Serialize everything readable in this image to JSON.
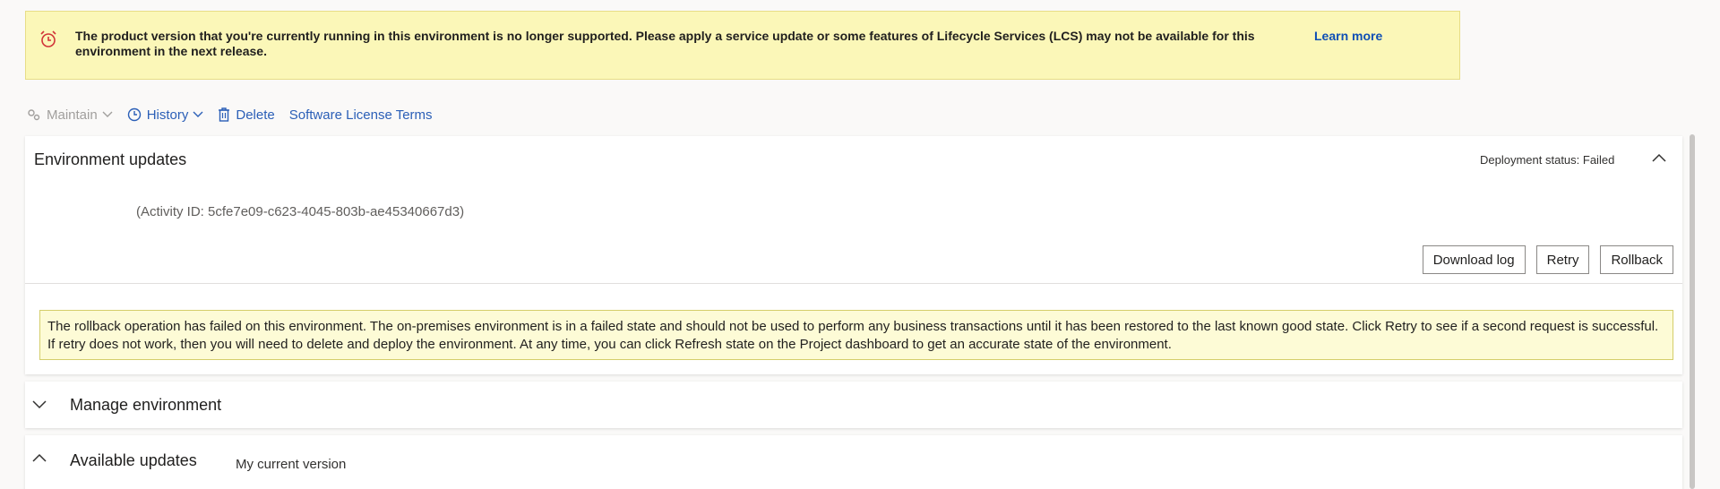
{
  "banner": {
    "icon": "clock-alert-icon",
    "message": "The product version that you're currently running in this environment is no longer supported. Please apply a service update or some features of Lifecycle Services (LCS) may not be available for this environment in the next release.",
    "link": "Learn more",
    "background": "#fbf7b8"
  },
  "toolbar": {
    "maintain": "Maintain",
    "history": "History",
    "delete": "Delete",
    "license": "Software License Terms"
  },
  "env_updates": {
    "title": "Environment updates",
    "deployment_status": "Deployment status: Failed",
    "activity": "(Activity ID: 5cfe7e09-c623-4045-803b-ae45340667d3)",
    "buttons": {
      "download_log": "Download log",
      "retry": "Retry",
      "rollback": "Rollback"
    },
    "warning": "The rollback operation has failed on this environment. The on-premises environment is in a failed state and should not be used to perform any business transactions until it has been restored to the last known good state. Click Retry to see if a second request is successful. If retry does not work, then you will need to delete and deploy the environment. At any time, you can click Refresh state on the Project dashboard to get an accurate state of the environment."
  },
  "manage": {
    "title": "Manage environment"
  },
  "available": {
    "title": "Available updates",
    "subtitle": "My current version"
  },
  "colors": {
    "accent": "#2b5fb7",
    "link": "#0f4fb5",
    "warning_bg": "#fdfbd6",
    "alert": "#d13438"
  }
}
